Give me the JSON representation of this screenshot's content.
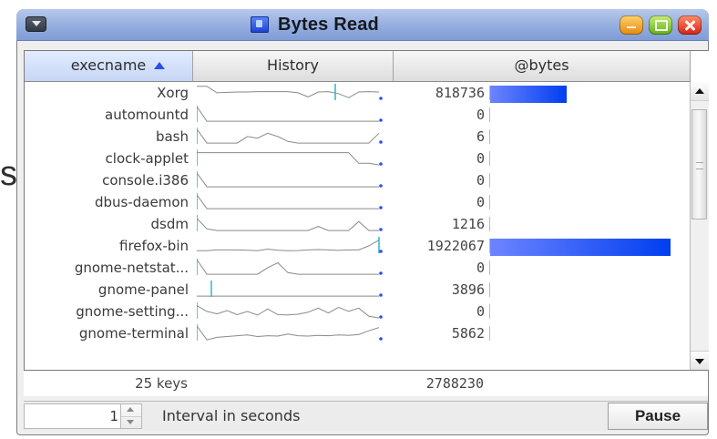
{
  "window": {
    "title": "Bytes Read",
    "menu_icon": "window-menu-icon",
    "app_icon": "app-icon",
    "controls": [
      "minimize-icon",
      "maximize-icon",
      "close-icon"
    ]
  },
  "outside_fragment": "s",
  "table": {
    "headers": [
      "execname",
      "History",
      "@bytes"
    ],
    "sorted_column": "execname",
    "sort_direction": "ascending",
    "rows": [
      {
        "name": "Xorg",
        "value": "818736",
        "bar_fraction": 0.426,
        "history": [
          0.15,
          0.15,
          0.55,
          0.52,
          0.5,
          0.5,
          0.48,
          0.48,
          0.48,
          0.48,
          0.55,
          0.8,
          0.5,
          0.48,
          0.6,
          0.85,
          0.5,
          0.48,
          0.5
        ],
        "marker_tick": 0.76
      },
      {
        "name": "automountd",
        "value": "0",
        "bar_fraction": 0,
        "history": [
          0.05,
          0.95,
          0.95,
          0.95,
          0.95,
          0.95,
          0.95,
          0.95,
          0.95,
          0.95,
          0.95,
          0.95,
          0.95,
          0.95,
          0.95,
          0.95,
          0.95,
          0.95,
          0.95
        ],
        "marker_tick": 0.0
      },
      {
        "name": "bash",
        "value": "6",
        "bar_fraction": 0.0,
        "history": [
          0.1,
          0.95,
          0.95,
          0.95,
          0.95,
          0.55,
          0.65,
          0.35,
          0.55,
          0.85,
          0.95,
          0.95,
          0.95,
          0.95,
          0.95,
          0.95,
          0.95,
          0.95,
          0.35
        ],
        "marker_tick": 0.0
      },
      {
        "name": "clock-applet",
        "value": "0",
        "bar_fraction": 0,
        "history": [
          0.2,
          0.2,
          0.2,
          0.2,
          0.2,
          0.2,
          0.2,
          0.2,
          0.2,
          0.2,
          0.2,
          0.2,
          0.2,
          0.2,
          0.2,
          0.2,
          0.85,
          0.85,
          0.95
        ],
        "marker_tick": 0.0
      },
      {
        "name": "console.i386",
        "value": "0",
        "bar_fraction": 0,
        "history": [
          0.1,
          0.95,
          0.95,
          0.95,
          0.95,
          0.95,
          0.95,
          0.95,
          0.95,
          0.95,
          0.95,
          0.95,
          0.95,
          0.95,
          0.95,
          0.95,
          0.95,
          0.95,
          0.95
        ],
        "marker_tick": 0.0
      },
      {
        "name": "dbus-daemon",
        "value": "0",
        "bar_fraction": 0,
        "history": [
          0.1,
          0.95,
          0.95,
          0.95,
          0.95,
          0.95,
          0.95,
          0.95,
          0.95,
          0.95,
          0.95,
          0.95,
          0.95,
          0.95,
          0.95,
          0.95,
          0.95,
          0.95,
          0.95
        ],
        "marker_tick": 0.0
      },
      {
        "name": "dsdm",
        "value": "1216",
        "bar_fraction": 0.0,
        "history": [
          0.2,
          0.85,
          0.95,
          0.95,
          0.95,
          0.95,
          0.95,
          0.95,
          0.95,
          0.95,
          0.95,
          0.95,
          0.7,
          0.95,
          0.95,
          0.95,
          0.4,
          0.95,
          0.95
        ],
        "marker_tick": 0.0
      },
      {
        "name": "firefox-bin",
        "value": "1922067",
        "bar_fraction": 1.0,
        "history": [
          0.85,
          0.85,
          0.8,
          0.8,
          0.8,
          0.82,
          0.85,
          0.75,
          0.82,
          0.85,
          0.84,
          0.8,
          0.78,
          0.8,
          0.83,
          0.8,
          0.8,
          0.55,
          0.2
        ],
        "marker_tick": 1.0
      },
      {
        "name": "gnome-netstat...",
        "value": "0",
        "bar_fraction": 0,
        "history": [
          0.05,
          0.95,
          0.95,
          0.95,
          0.95,
          0.95,
          0.95,
          0.55,
          0.25,
          0.85,
          0.95,
          0.95,
          0.95,
          0.95,
          0.95,
          0.95,
          0.95,
          0.95,
          0.95
        ],
        "marker_tick": 0.0
      },
      {
        "name": "gnome-panel",
        "value": "3896",
        "bar_fraction": 0.0,
        "history": [
          0.95,
          0.95,
          0.95,
          0.95,
          0.95,
          0.95,
          0.95,
          0.95,
          0.95,
          0.95,
          0.95,
          0.95,
          0.95,
          0.95,
          0.95,
          0.95,
          0.95,
          0.95,
          0.95
        ],
        "marker_tick": 0.08
      },
      {
        "name": "gnome-setting...",
        "value": "0",
        "bar_fraction": 0,
        "history": [
          0.2,
          0.55,
          0.7,
          0.5,
          0.75,
          0.55,
          0.78,
          0.4,
          0.75,
          0.76,
          0.72,
          0.6,
          0.35,
          0.65,
          0.3,
          0.55,
          0.35,
          0.85,
          0.95
        ],
        "marker_tick": 0.0
      },
      {
        "name": "gnome-terminal",
        "value": "5862",
        "bar_fraction": 0.0,
        "history": [
          0.1,
          0.95,
          0.8,
          0.75,
          0.7,
          0.65,
          0.75,
          0.7,
          0.72,
          0.6,
          0.7,
          0.72,
          0.68,
          0.7,
          0.65,
          0.68,
          0.62,
          0.4,
          0.2
        ],
        "marker_tick": 0.0
      }
    ]
  },
  "summary": {
    "keys_label": "25 keys",
    "total_bytes": "2788230"
  },
  "controls": {
    "interval_value": "1",
    "interval_label": "Interval in seconds",
    "pause_label": "Pause"
  },
  "colors": {
    "titlebar_top": "#b7c8ea",
    "titlebar_bottom": "#7f9cd7",
    "bar_start": "#6d84ff",
    "bar_end": "#003ef0",
    "history_line": "#8a8a8a",
    "history_tick": "#28b9c8",
    "history_dot": "#2b4cff"
  }
}
